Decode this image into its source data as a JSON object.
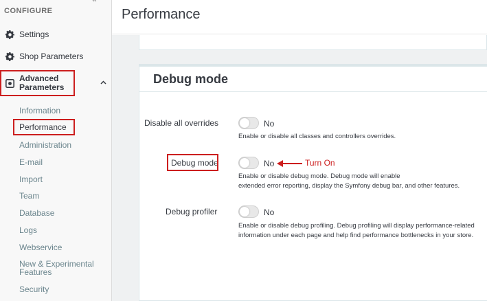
{
  "sidebar": {
    "section_title": "CONFIGURE",
    "collapse_glyph": "«",
    "items": [
      {
        "label": "Settings",
        "icon": "gear-icon"
      },
      {
        "label": "Shop Parameters",
        "icon": "gear-icon"
      },
      {
        "label": "Advanced Parameters",
        "icon": "advanced-icon",
        "expanded": true
      }
    ],
    "sub_items": [
      "Information",
      "Performance",
      "Administration",
      "E-mail",
      "Import",
      "Team",
      "Database",
      "Logs",
      "Webservice",
      "New & Experimental Features",
      "Security"
    ],
    "active_sub_item": "Performance"
  },
  "header": {
    "title": "Performance"
  },
  "debug_card": {
    "title": "Debug mode",
    "rows": [
      {
        "label": "Disable all overrides",
        "value": "No",
        "enabled": false,
        "help": [
          "Enable or disable all classes and controllers overrides."
        ]
      },
      {
        "label": "Debug mode",
        "value": "No",
        "enabled": false,
        "help": [
          "Enable or disable debug mode. Debug mode will enable",
          "extended error reporting, display the Symfony debug bar, and other features."
        ]
      },
      {
        "label": "Debug profiler",
        "value": "No",
        "enabled": false,
        "help": [
          "Enable or disable debug profiling. Debug profiling will display performance-related",
          "information under each page and help find performance bottlenecks in your store."
        ]
      }
    ]
  },
  "annotation": {
    "text": "Turn On",
    "color": "#cc1e1e"
  },
  "colors": {
    "highlight": "#cc1e1e",
    "sidebar_bg": "#f8f8f8",
    "main_bg": "#eff1f2"
  }
}
